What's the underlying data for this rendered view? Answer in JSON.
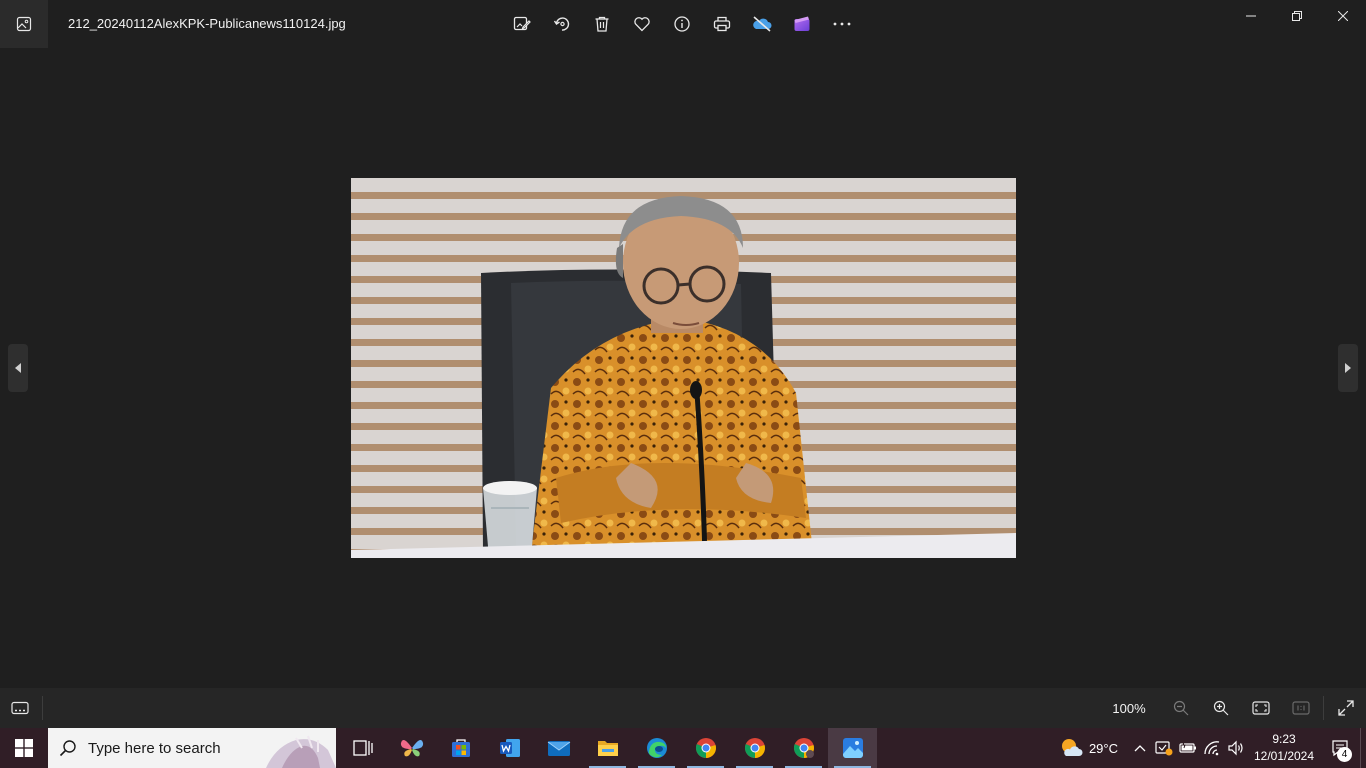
{
  "window": {
    "filename": "212_20240112AlexKPK-Publicanews110124.jpg"
  },
  "toolbar": {
    "items": [
      {
        "name": "edit-image",
        "icon": "edit-image-icon"
      },
      {
        "name": "rotate",
        "icon": "rotate-icon"
      },
      {
        "name": "delete",
        "icon": "trash-icon"
      },
      {
        "name": "favorite",
        "icon": "heart-icon"
      },
      {
        "name": "file-info",
        "icon": "info-icon"
      },
      {
        "name": "print",
        "icon": "printer-icon"
      },
      {
        "name": "onedrive",
        "icon": "cloud-off-icon"
      },
      {
        "name": "clipchamp",
        "icon": "clipchamp-icon"
      },
      {
        "name": "more",
        "icon": "more-icon"
      }
    ]
  },
  "bottombar": {
    "zoom_level": "100%"
  },
  "taskbar": {
    "search_placeholder": "Type here to search",
    "apps": [
      {
        "name": "task-view",
        "icon": "task-view-icon"
      },
      {
        "name": "copilot",
        "icon": "butterfly-icon"
      },
      {
        "name": "store",
        "icon": "store-icon"
      },
      {
        "name": "word",
        "icon": "word-icon"
      },
      {
        "name": "mail",
        "icon": "mail-icon"
      },
      {
        "name": "file-explorer",
        "icon": "folder-icon"
      },
      {
        "name": "edge",
        "icon": "edge-icon"
      },
      {
        "name": "chrome-1",
        "icon": "chrome-icon"
      },
      {
        "name": "chrome-2",
        "icon": "chrome-icon"
      },
      {
        "name": "chrome-3",
        "icon": "chrome-icon"
      },
      {
        "name": "photos",
        "icon": "photos-icon"
      }
    ],
    "weather": "29°C",
    "time": "9:23",
    "date": "12/01/2024",
    "notification_count": "4"
  },
  "colors": {
    "background": "#1f1f1f",
    "taskbar": "#301e26",
    "accent": "#8fb7e0"
  }
}
